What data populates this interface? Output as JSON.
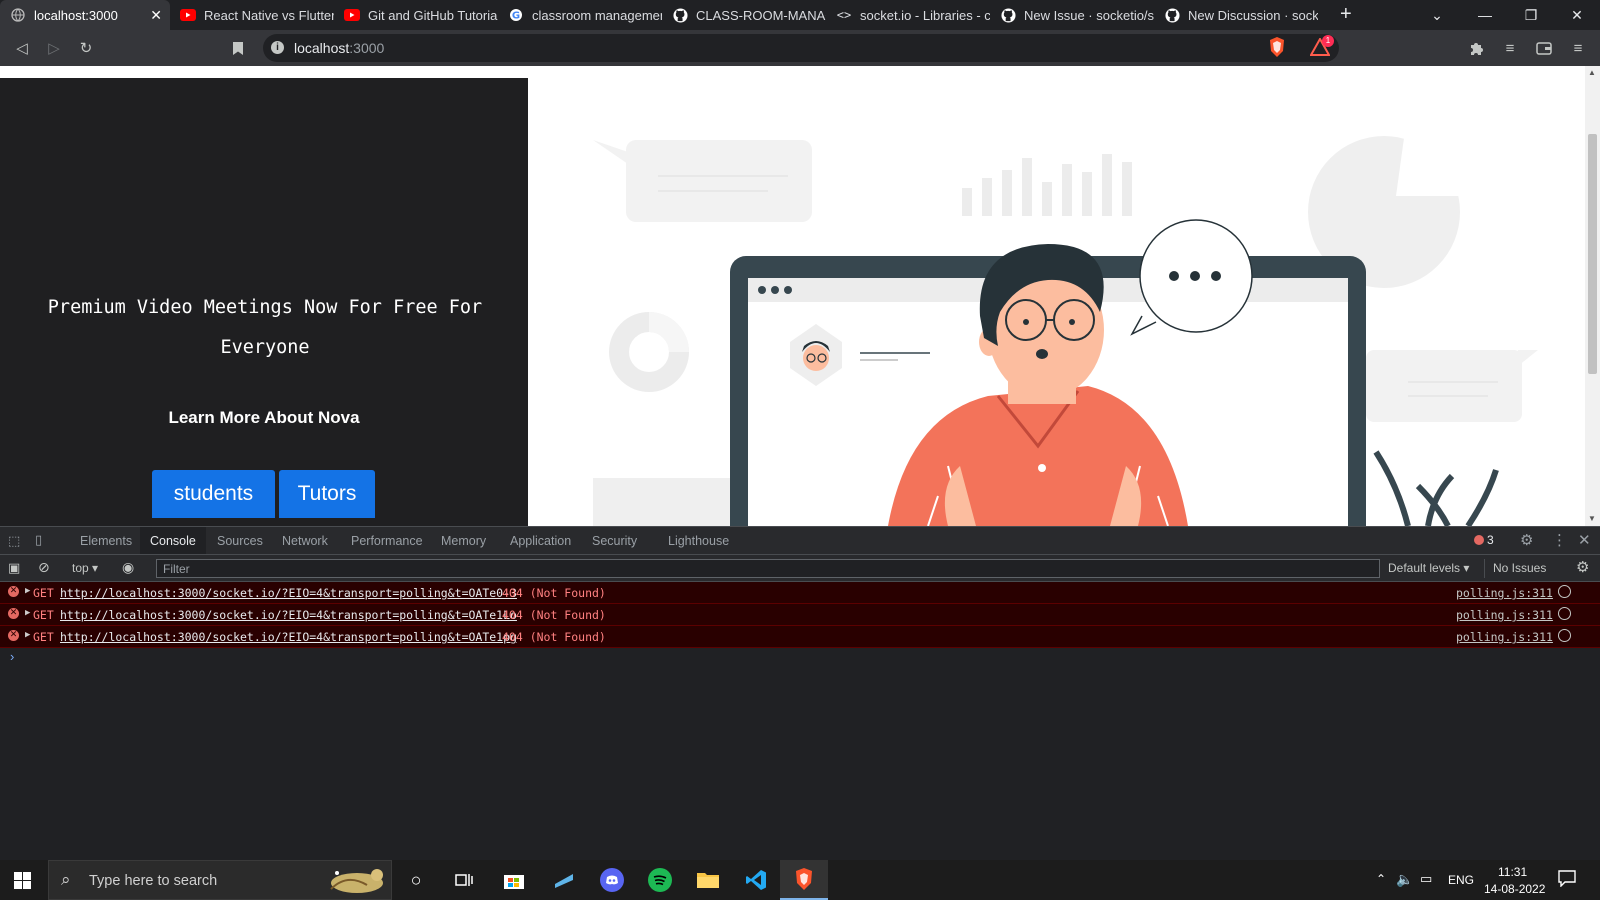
{
  "browser": {
    "tabs": [
      {
        "title": "localhost:3000",
        "icon": "globe-icon",
        "active": true
      },
      {
        "title": "React Native vs Flutter M",
        "icon": "youtube-icon"
      },
      {
        "title": "Git and GitHub Tutorials",
        "icon": "youtube-icon"
      },
      {
        "title": "classroom management",
        "icon": "google-icon"
      },
      {
        "title": "CLASS-ROOM-MANAGE",
        "icon": "github-icon"
      },
      {
        "title": "socket.io - Libraries - cd",
        "icon": "code-icon"
      },
      {
        "title": "New Issue · socketio/soc",
        "icon": "github-icon"
      },
      {
        "title": "New Discussion · socket",
        "icon": "github-icon"
      }
    ],
    "new_tab": "+",
    "address": {
      "host": "localhost",
      "port": ":3000"
    },
    "notification_count": "1"
  },
  "page": {
    "hero_title": "Premium Video Meetings Now For Free For Everyone",
    "learn_more": "Learn More About Nova",
    "buttons": {
      "students": "students",
      "tutors": "Tutors"
    }
  },
  "devtools": {
    "tabs": [
      "Elements",
      "Console",
      "Sources",
      "Network",
      "Performance",
      "Memory",
      "Application",
      "Security",
      "Lighthouse"
    ],
    "active_tab": "Console",
    "error_count": "3",
    "context": "top",
    "filter_placeholder": "Filter",
    "levels": "Default levels",
    "issues": "No Issues",
    "logs": [
      {
        "method": "GET",
        "url": "http://localhost:3000/socket.io/?EIO=4&transport=polling&t=OATe0-3",
        "status": "404 (Not Found)",
        "source": "polling.js:311"
      },
      {
        "method": "GET",
        "url": "http://localhost:3000/socket.io/?EIO=4&transport=polling&t=OATe1Lo",
        "status": "404 (Not Found)",
        "source": "polling.js:311"
      },
      {
        "method": "GET",
        "url": "http://localhost:3000/socket.io/?EIO=4&transport=polling&t=OATe1pg",
        "status": "404 (Not Found)",
        "source": "polling.js:311"
      }
    ],
    "prompt": "›"
  },
  "taskbar": {
    "search_placeholder": "Type here to search",
    "language": "ENG",
    "time": "11:31",
    "date": "14-08-2022"
  },
  "colors": {
    "accent_button": "#1473e6",
    "hero_dark": "#1f1f21",
    "error_bg": "#290000",
    "shirt": "#f3735a",
    "monitor": "#37474f"
  }
}
